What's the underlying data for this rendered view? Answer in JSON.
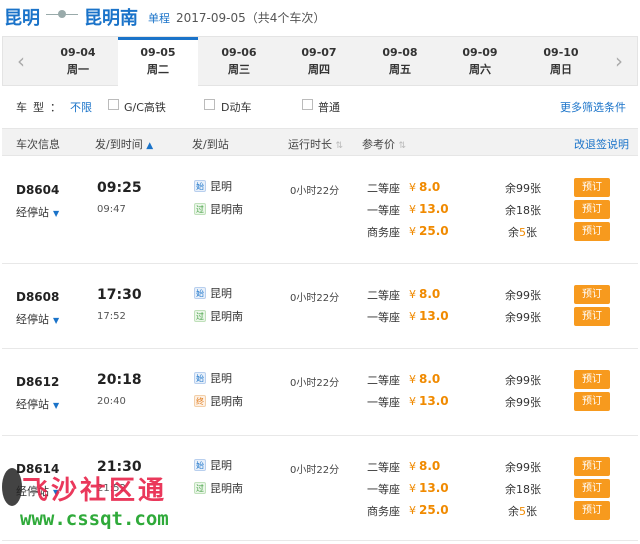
{
  "header": {
    "from_city": "昆明",
    "to_city": "昆明南",
    "trip_type": "单程",
    "date_summary": "2017-09-05（共4个车次）"
  },
  "dates": [
    {
      "date": "09-04",
      "weekday": "周一",
      "active": false
    },
    {
      "date": "09-05",
      "weekday": "周二",
      "active": true
    },
    {
      "date": "09-06",
      "weekday": "周三",
      "active": false
    },
    {
      "date": "09-07",
      "weekday": "周四",
      "active": false
    },
    {
      "date": "09-08",
      "weekday": "周五",
      "active": false
    },
    {
      "date": "09-09",
      "weekday": "周六",
      "active": false
    },
    {
      "date": "09-10",
      "weekday": "周日",
      "active": false
    }
  ],
  "nav": {
    "prev": "‹",
    "next": "›"
  },
  "filters": {
    "label": "车型：",
    "all": "不限",
    "options": [
      "G/C高铁",
      "D动车",
      "普通"
    ],
    "more": "更多筛选条件"
  },
  "columns": {
    "train_info": "车次信息",
    "dep_arr_time": "发/到时间",
    "dep_arr_station": "发/到站",
    "duration": "运行时长",
    "price": "参考价",
    "change_rules": "改退签说明",
    "sort_up": "▲",
    "sort_both": "⇅"
  },
  "trains": [
    {
      "train_no": "D8604",
      "stops_label": "经停站",
      "dep_time": "09:25",
      "arr_time": "09:47",
      "dep_tag": "始",
      "dep_station": "昆明",
      "arr_tag": "过",
      "arr_station": "昆明南",
      "duration": "0小时22分",
      "seats": [
        {
          "name": "二等座",
          "price": "8.0",
          "remain": "余99张",
          "book": "预订"
        },
        {
          "name": "一等座",
          "price": "13.0",
          "remain": "余18张",
          "book": "预订"
        },
        {
          "name": "商务座",
          "price": "25.0",
          "remain_prefix": "余",
          "remain_num": "5",
          "remain_suffix": "张",
          "book": "预订"
        }
      ]
    },
    {
      "train_no": "D8608",
      "stops_label": "经停站",
      "dep_time": "17:30",
      "arr_time": "17:52",
      "dep_tag": "始",
      "dep_station": "昆明",
      "arr_tag": "过",
      "arr_station": "昆明南",
      "duration": "0小时22分",
      "seats": [
        {
          "name": "二等座",
          "price": "8.0",
          "remain": "余99张",
          "book": "预订"
        },
        {
          "name": "一等座",
          "price": "13.0",
          "remain": "余99张",
          "book": "预订"
        }
      ]
    },
    {
      "train_no": "D8612",
      "stops_label": "经停站",
      "dep_time": "20:18",
      "arr_time": "20:40",
      "dep_tag": "始",
      "dep_station": "昆明",
      "arr_tag": "终",
      "arr_station": "昆明南",
      "duration": "0小时22分",
      "seats": [
        {
          "name": "二等座",
          "price": "8.0",
          "remain": "余99张",
          "book": "预订"
        },
        {
          "name": "一等座",
          "price": "13.0",
          "remain": "余99张",
          "book": "预订"
        }
      ]
    },
    {
      "train_no": "D8614",
      "stops_label": "经停站",
      "dep_time": "21:30",
      "arr_time": "21:52",
      "dep_tag": "始",
      "dep_station": "昆明",
      "arr_tag": "过",
      "arr_station": "昆明南",
      "duration": "0小时22分",
      "seats": [
        {
          "name": "二等座",
          "price": "8.0",
          "remain": "余99张",
          "book": "预订"
        },
        {
          "name": "一等座",
          "price": "13.0",
          "remain": "余18张",
          "book": "预订"
        },
        {
          "name": "商务座",
          "price": "25.0",
          "remain_prefix": "余",
          "remain_num": "5",
          "remain_suffix": "张",
          "book": "预订"
        }
      ]
    }
  ],
  "currency": "¥",
  "watermark": {
    "title": "飞沙社区通",
    "url": "www.cssqt.com"
  },
  "colors": {
    "accent": "#1a73c9",
    "price": "#f08a00",
    "book_button": "#f79a1e"
  }
}
